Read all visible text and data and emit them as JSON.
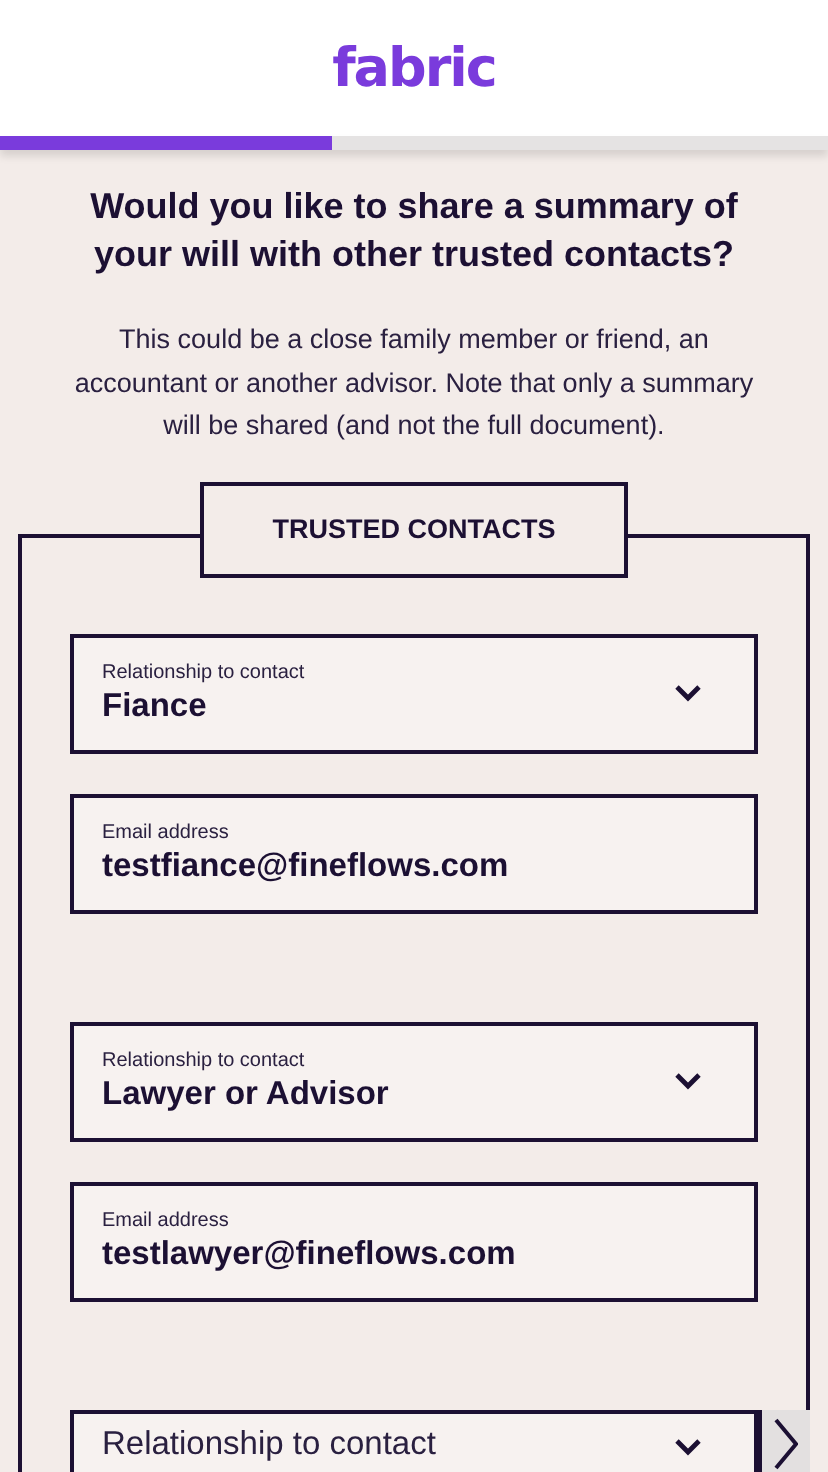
{
  "header": {
    "logo": "fabric"
  },
  "progress": {
    "level": 0.4
  },
  "title": "Would you like to share a summary of your will with other trusted contacts?",
  "intro": "This could be a close family member or friend, an accountant or another advisor. Note that only a summary will be shared (and not the full document).",
  "section": {
    "legend": "TRUSTED CONTACTS",
    "contacts": [
      {
        "relationship": {
          "label": "Relationship to contact",
          "value": "Fiance"
        },
        "email": {
          "label": "Email address",
          "value": "testfiance@fineflows.com"
        }
      },
      {
        "relationship": {
          "label": "Relationship to contact",
          "value": "Lawyer or Advisor"
        },
        "email": {
          "label": "Email address",
          "value": "testlawyer@fineflows.com"
        }
      },
      {
        "relationship": {
          "placeholder": "Relationship to contact"
        }
      }
    ]
  }
}
